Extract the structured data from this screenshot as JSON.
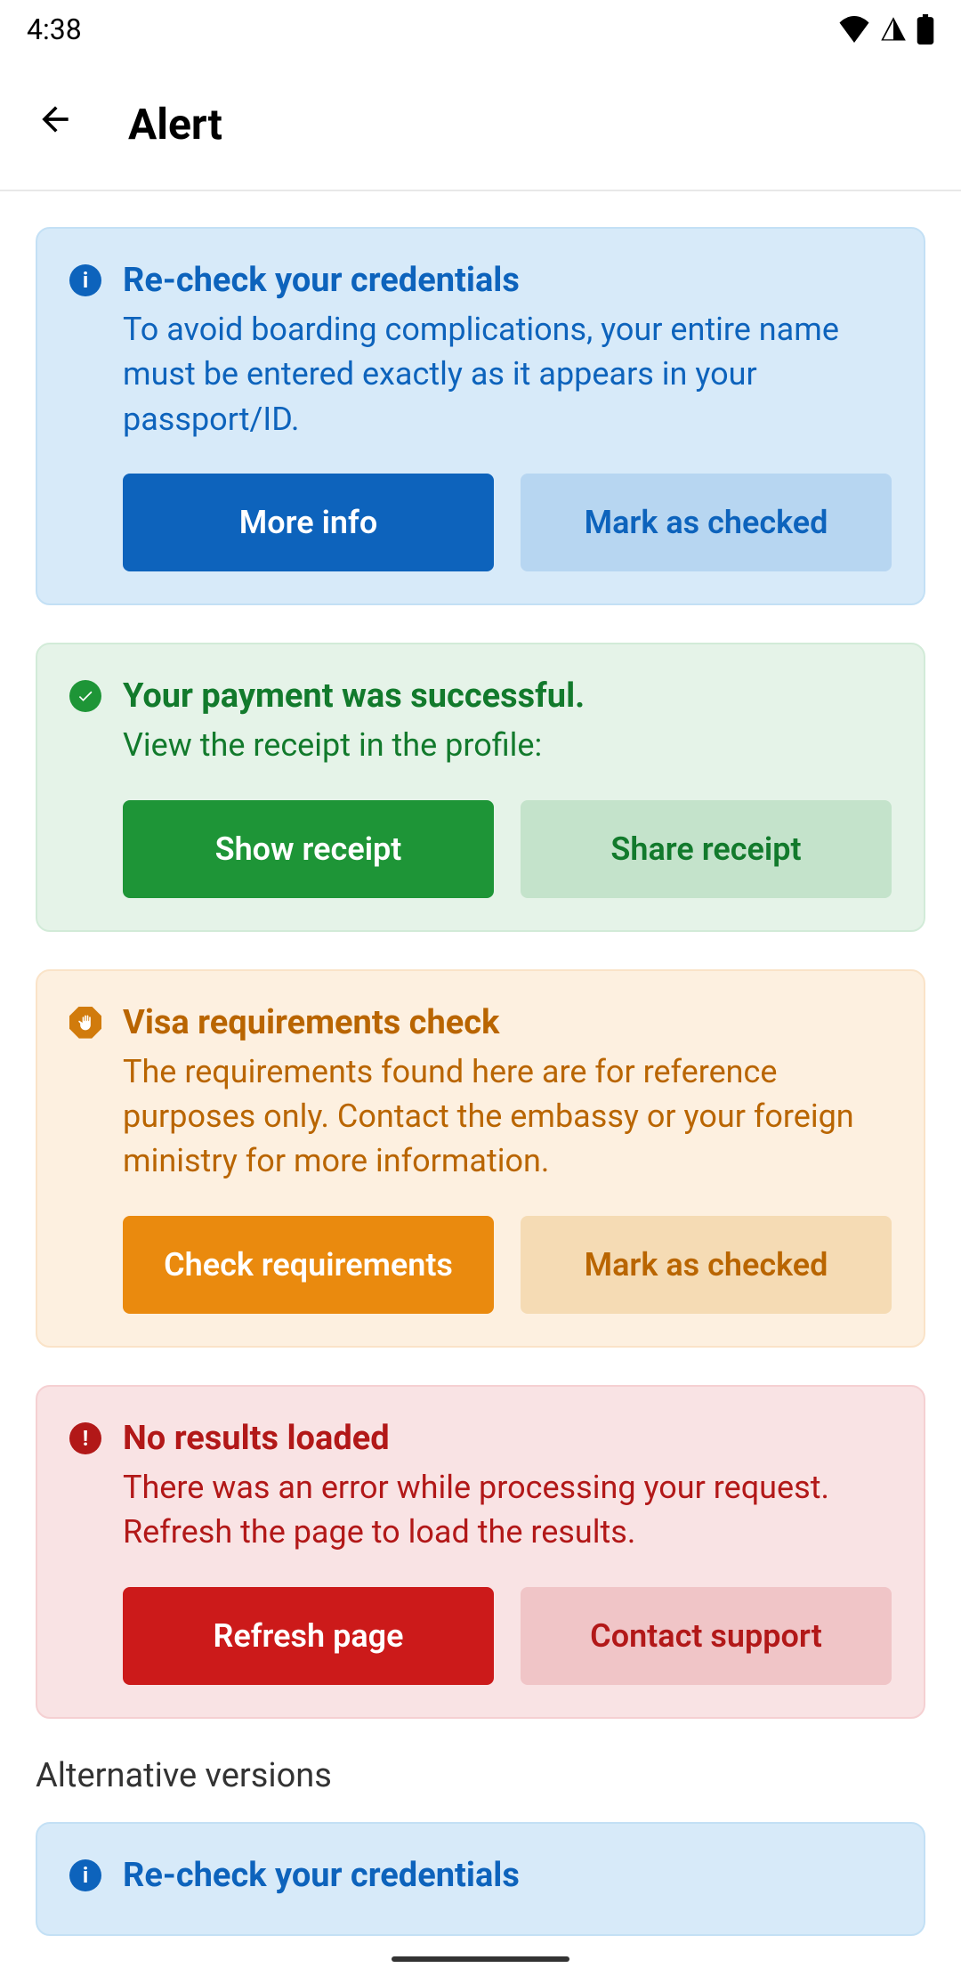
{
  "status": {
    "time": "4:38"
  },
  "header": {
    "title": "Alert"
  },
  "alerts": [
    {
      "variant": "info",
      "title": "Re-check your credentials",
      "text": "To avoid boarding complications, your entire name must be entered exactly as it appears in your passport/ID.",
      "primary": "More info",
      "secondary": "Mark as checked"
    },
    {
      "variant": "success",
      "title": "Your payment was successful.",
      "text": "View the receipt in the profile:",
      "primary": "Show receipt",
      "secondary": "Share receipt"
    },
    {
      "variant": "warning",
      "title": "Visa requirements check",
      "text": "The requirements found here are for reference purposes only. Contact the embassy or your foreign ministry for more information.",
      "primary": "Check requirements",
      "secondary": "Mark as checked"
    },
    {
      "variant": "error",
      "title": "No results loaded",
      "text": "There was an error while processing your request. Refresh the page to load the results.",
      "primary": "Refresh page",
      "secondary": "Contact support"
    }
  ],
  "sectionLabel": "Alternative versions",
  "altAlert": {
    "title": "Re-check your credentials"
  }
}
